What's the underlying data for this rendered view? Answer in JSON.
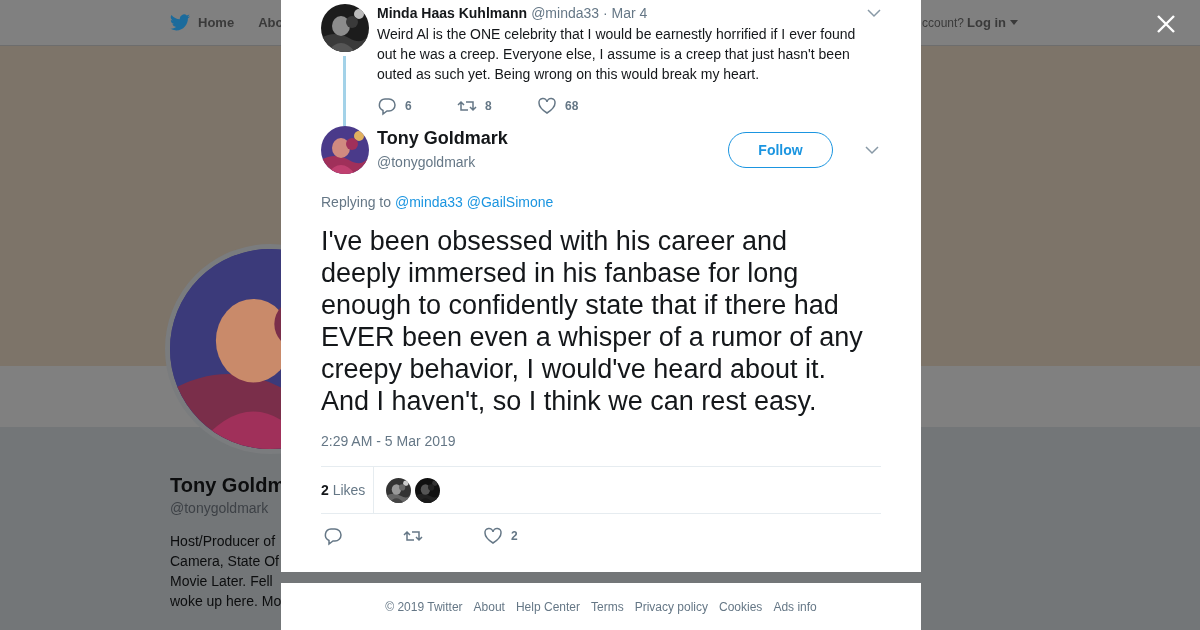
{
  "background_page": {
    "nav": [
      {
        "kind": "home",
        "label": "Home"
      },
      {
        "kind": "plain",
        "label": "Abo"
      }
    ],
    "account_prompt": "ccount?",
    "login": "Log in",
    "profile": {
      "name": "Tony Goldm",
      "handle": "@tonygoldmark",
      "bio_lines": [
        "Host/Producer of",
        "Camera, State Of",
        "Movie Later. Fell",
        "woke up here. Mo"
      ]
    }
  },
  "modal": {
    "parent_tweet": {
      "name": "Minda Haas Kuhlmann",
      "handle": "@minda33",
      "date": "· Mar 4",
      "text": "Weird Al is the ONE celebrity that I would be earnestly horrified if I ever found out he was a creep. Everyone else, I assume is a creep that just hasn't been outed as such yet. Being wrong on this would break my heart.",
      "actions": [
        {
          "kind": "reply",
          "count": "6"
        },
        {
          "kind": "retweet",
          "count": "8"
        },
        {
          "kind": "like",
          "count": "68"
        }
      ]
    },
    "tweet": {
      "name": "Tony Goldmark",
      "handle": "@tonygoldmark",
      "follow": "Follow",
      "replying_label": "Replying to",
      "replying_to": [
        "@minda33",
        "@GailSimone"
      ],
      "text": "I've been obsessed with his career and deeply immersed in his fanbase for long enough to confidently state that if there had EVER been even a whisper of a rumor of any creepy behavior, I would've heard about it. And I haven't, so I think we can rest easy.",
      "timestamp": "2:29 AM - 5 Mar 2019",
      "likes_count": "2",
      "likes_label": "Likes",
      "likers": [
        {
          "kind": "picture"
        },
        {
          "kind": "picture"
        }
      ],
      "actions": [
        {
          "kind": "reply"
        },
        {
          "kind": "retweet"
        },
        {
          "kind": "like",
          "count": "2"
        }
      ]
    },
    "footer": [
      "© 2019 Twitter",
      "About",
      "Help Center",
      "Terms",
      "Privacy policy",
      "Cookies",
      "Ads info"
    ]
  }
}
